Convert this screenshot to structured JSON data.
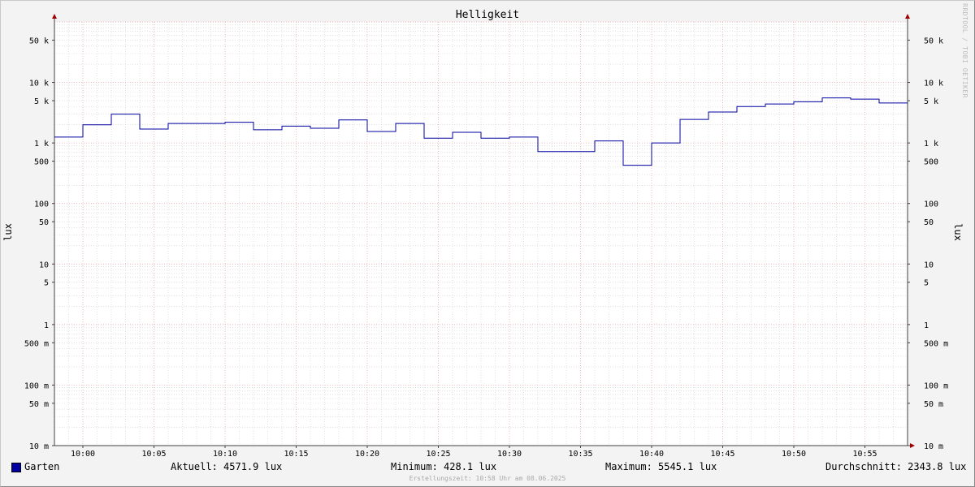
{
  "window": {
    "watermark": "RRDTOOL / TOBI OETIKER",
    "footer": "Erstellungszeit: 10:58 Uhr am 08.06.2025"
  },
  "legend": {
    "series_name": "Garten",
    "current": "Aktuell: 4571.9 lux",
    "minimum": "Minimum: 428.1 lux",
    "maximum": "Maximum: 5545.1 lux",
    "average": "Durchschnitt: 2343.8 lux"
  },
  "colors": {
    "line": "#0000a0",
    "major_grid": "#e8a0a0",
    "minor_grid": "#cfcfcf",
    "axis": "#404040",
    "arrow": "#a00000"
  },
  "chart_data": {
    "type": "line",
    "title": "Helligkeit",
    "ylabel": "lux",
    "xlabel": "",
    "y_scale": "log",
    "ylim": [
      0.01,
      100000
    ],
    "xlim": [
      "09:58",
      "10:58"
    ],
    "grid": true,
    "x_ticks": [
      "10:00",
      "10:05",
      "10:10",
      "10:15",
      "10:20",
      "10:25",
      "10:30",
      "10:35",
      "10:40",
      "10:45",
      "10:50",
      "10:55"
    ],
    "y_ticks": [
      {
        "value": 50000,
        "label": "50 k"
      },
      {
        "value": 10000,
        "label": "10 k"
      },
      {
        "value": 5000,
        "label": "5 k"
      },
      {
        "value": 1000,
        "label": "1 k"
      },
      {
        "value": 500,
        "label": "500"
      },
      {
        "value": 100,
        "label": "100"
      },
      {
        "value": 50,
        "label": "50"
      },
      {
        "value": 10,
        "label": "10"
      },
      {
        "value": 5,
        "label": "5"
      },
      {
        "value": 1,
        "label": "1"
      },
      {
        "value": 0.5,
        "label": "500 m"
      },
      {
        "value": 0.1,
        "label": "100 m"
      },
      {
        "value": 0.05,
        "label": "50 m"
      },
      {
        "value": 0.01,
        "label": "10 m"
      }
    ],
    "series": [
      {
        "name": "Garten",
        "step": true,
        "points": [
          {
            "x": "09:58",
            "y": 1250
          },
          {
            "x": "10:00",
            "y": 2000
          },
          {
            "x": "10:02",
            "y": 3000
          },
          {
            "x": "10:04",
            "y": 1700
          },
          {
            "x": "10:06",
            "y": 2100
          },
          {
            "x": "10:10",
            "y": 2200
          },
          {
            "x": "10:12",
            "y": 1650
          },
          {
            "x": "10:14",
            "y": 1900
          },
          {
            "x": "10:16",
            "y": 1750
          },
          {
            "x": "10:18",
            "y": 2400
          },
          {
            "x": "10:20",
            "y": 1550
          },
          {
            "x": "10:22",
            "y": 2100
          },
          {
            "x": "10:24",
            "y": 1200
          },
          {
            "x": "10:26",
            "y": 1500
          },
          {
            "x": "10:28",
            "y": 1200
          },
          {
            "x": "10:30",
            "y": 1250
          },
          {
            "x": "10:32",
            "y": 720
          },
          {
            "x": "10:36",
            "y": 1080
          },
          {
            "x": "10:38",
            "y": 428.1
          },
          {
            "x": "10:40",
            "y": 1000
          },
          {
            "x": "10:42",
            "y": 2450
          },
          {
            "x": "10:44",
            "y": 3250
          },
          {
            "x": "10:46",
            "y": 4000
          },
          {
            "x": "10:48",
            "y": 4400
          },
          {
            "x": "10:50",
            "y": 4800
          },
          {
            "x": "10:52",
            "y": 5545.1
          },
          {
            "x": "10:54",
            "y": 5300
          },
          {
            "x": "10:56",
            "y": 4571.9
          },
          {
            "x": "10:58",
            "y": 4571.9
          }
        ]
      }
    ]
  }
}
